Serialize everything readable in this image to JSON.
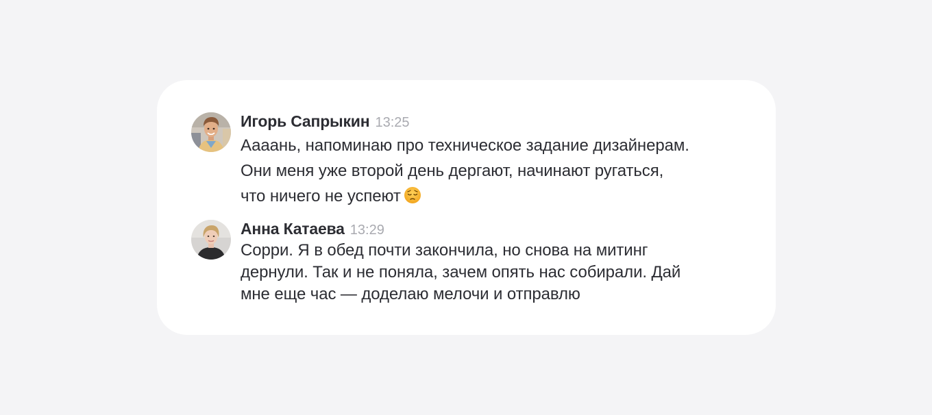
{
  "messages": [
    {
      "author": "Игорь Сапрыкин",
      "time": "13:25",
      "avatar_icon": "avatar-man-photo",
      "lines": [
        "Аааань, напоминаю про техническое задание дизайнерам.",
        "Они меня уже второй день дергают, начинают ругаться,",
        "что ничего не успеют"
      ],
      "trailing_emoji": "pensive-face-emoji"
    },
    {
      "author": "Анна Катаева",
      "time": "13:29",
      "avatar_icon": "avatar-woman-photo",
      "lines": [
        "Сорри. Я в обед почти закончила, но снова на митинг",
        "дернули. Так и не поняла, зачем опять нас собирали. Дай",
        "мне еще час — доделаю мелочи и отправлю"
      ]
    }
  ],
  "colors": {
    "page_background": "#f4f4f6",
    "card_background": "#ffffff",
    "text": "#2c2d33",
    "timestamp": "#a9aab0"
  }
}
